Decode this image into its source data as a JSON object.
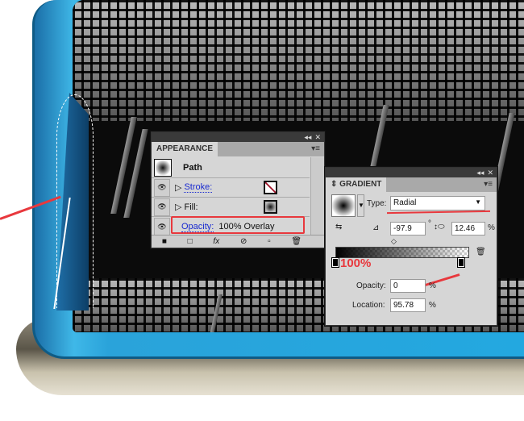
{
  "appearance": {
    "title": "APPEARANCE",
    "object": "Path",
    "rows": [
      {
        "label": "Stroke:"
      },
      {
        "label": "Fill:"
      },
      {
        "label": "Opacity:",
        "value": "100% Overlay"
      }
    ]
  },
  "gradient": {
    "title": "GRADIENT",
    "type_label": "Type:",
    "type_value": "Radial",
    "angle": "-97.9",
    "angle_unit": "°",
    "aspect": "12.46",
    "aspect_unit": "%",
    "stop_opacity_annotation": "100%",
    "opacity_label": "Opacity:",
    "opacity_value": "0",
    "opacity_unit": "%",
    "location_label": "Location:",
    "location_value": "95.78",
    "location_unit": "%"
  },
  "colors": {
    "annotation": "#e8383d",
    "link": "#1a2bd0",
    "frame": "#23a8e0"
  }
}
